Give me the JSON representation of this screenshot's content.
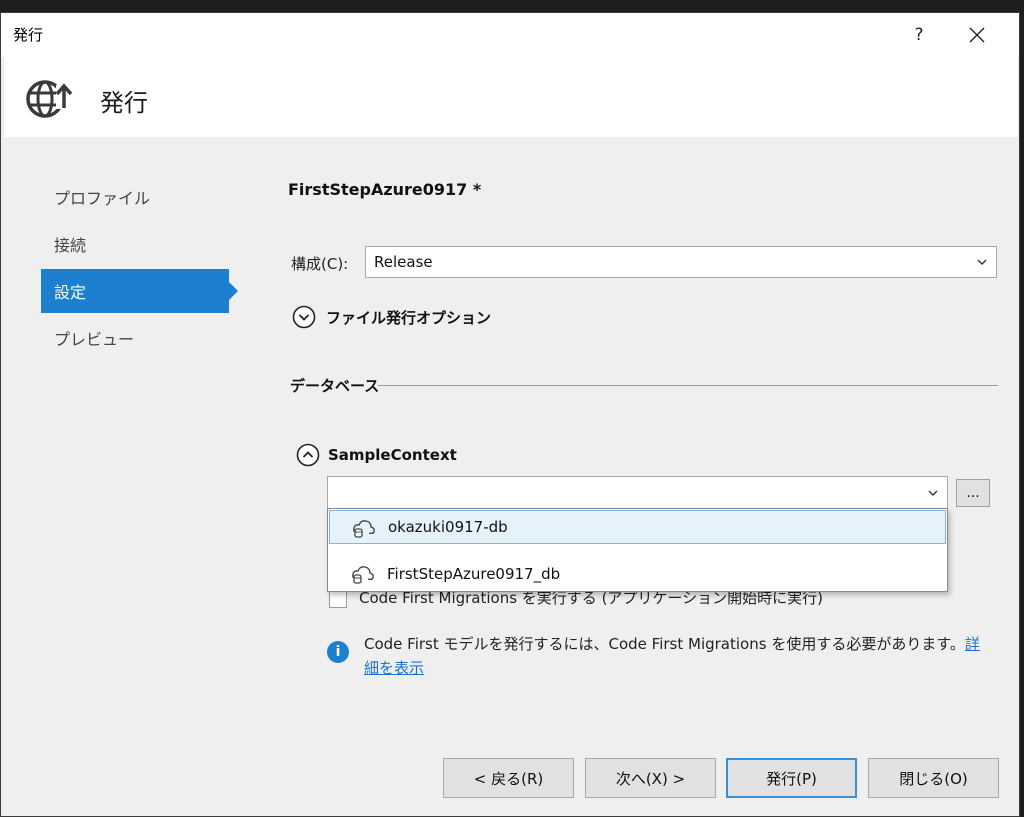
{
  "window": {
    "title": "発行",
    "help_glyph": "?"
  },
  "header": {
    "title": "発行",
    "icon": "globe-upload-icon"
  },
  "nav": {
    "items": [
      {
        "label": "プロファイル",
        "selected": false
      },
      {
        "label": "接続",
        "selected": false
      },
      {
        "label": "設定",
        "selected": true
      },
      {
        "label": "プレビュー",
        "selected": false
      }
    ]
  },
  "settings": {
    "profile_name": "FirstStepAzure0917 *",
    "config_label": "構成(C):",
    "config_value": "Release",
    "file_publish_options_label": "ファイル発行オプション"
  },
  "database": {
    "section_label": "データベース",
    "context_name": "SampleContext",
    "connection_value": "",
    "browse_label": "...",
    "dropdown_options": [
      {
        "label": "okazuki0917-db",
        "highlighted": true,
        "icon": "cloud-database-icon"
      },
      {
        "label": "FirstStepAzure0917_db",
        "highlighted": false,
        "icon": "cloud-database-icon"
      }
    ],
    "migrations_checkbox_label": "Code First Migrations を実行する (アプリケーション開始時に実行)",
    "migrations_checked": false,
    "info_text": "Code First モデルを発行するには、Code First Migrations を使用する必要があります。",
    "info_link": "詳細を表示"
  },
  "footer": {
    "back_label": "< 戻る(R)",
    "next_label": "次へ(X) >",
    "publish_label": "発行(P)",
    "close_label": "閉じる(O)"
  },
  "colors": {
    "accent": "#1c7fd0",
    "highlight_bg": "#e5f1fb",
    "highlight_border": "#7eb4ea"
  }
}
